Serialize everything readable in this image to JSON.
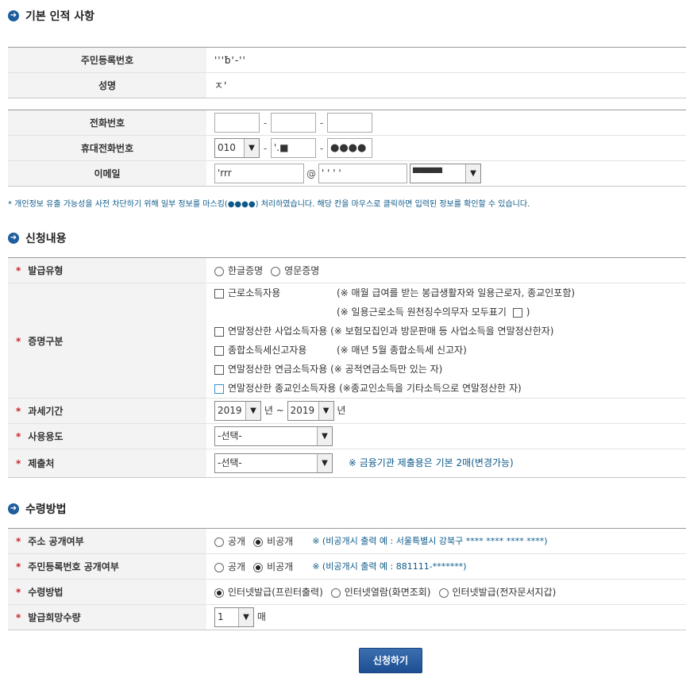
{
  "sections": {
    "basic": "기본 인적 사항",
    "request": "신청내용",
    "receive": "수령방법"
  },
  "personal": {
    "rrn_label": "주민등록번호",
    "rrn_value": "'''ƀ'-''",
    "name_label": "성명",
    "name_value": "ㅈ'"
  },
  "contact": {
    "phone_label": "전화번호",
    "phone_dash": "-",
    "mobile_label": "휴대전화번호",
    "mobile_prefix": "010",
    "mobile_mid": "'.■",
    "mobile_last": "●●●●",
    "email_label": "이메일",
    "email_id": "'rrr",
    "email_at": "@",
    "email_domain": "'   '  ' '",
    "email_domain_select": "▀▀▀▀"
  },
  "notice": "* 개인정보 유출 가능성을 사전 차단하기 위해 일부 정보를 마스킹(●●●●) 처리하였습니다. 해당 칸을 마우스로 클릭하면 입력된 정보를 확인할 수 있습니다.",
  "request": {
    "type_label": "발급유형",
    "type_korean": "한글증명",
    "type_english": "영문증명",
    "cert_label": "증명구분",
    "cert1": "근로소득자용",
    "cert1_note": "(※ 매월 급여를 받는 봉급생활자와 일용근로자, 종교인포함)",
    "cert1_sub": "(※ 일용근로소득 원천징수의무자 모두표기",
    "cert1_sub_end": ")",
    "cert2": "연말정산한 사업소득자용",
    "cert2_note": "(※ 보험모집인과 방문판매 등 사업소득을 연말정산한자)",
    "cert3": "종합소득세신고자용",
    "cert3_note": "(※ 매년 5월 종합소득세 신고자)",
    "cert4": "연말정산한 연금소득자용",
    "cert4_note": "(※ 공적연금소득만 있는 자)",
    "cert5": "연말정산한 종교인소득자용",
    "cert5_note": "(※종교인소득을 기타소득으로 연말정산한 자)",
    "period_label": "과세기간",
    "period_from": "2019",
    "period_year1": "년",
    "period_tilde": "~",
    "period_to": "2019",
    "period_year2": "년",
    "usage_label": "사용용도",
    "usage_value": "-선택-",
    "submit_to_label": "제출처",
    "submit_to_value": "-선택-",
    "submit_to_note": "※ 금융기관 제출용은 기본 2매(변경가능)"
  },
  "receive": {
    "addr_label": "주소 공개여부",
    "public": "공개",
    "private": "비공개",
    "addr_note": "※ (비공개시 출력 예 : 서울특별시 강북구 **** **** **** ****)",
    "rrn_label": "주민등록번호 공개여부",
    "rrn_note": "※ (비공개시 출력 예 : 881111-*******)",
    "method_label": "수령방법",
    "method1": "인터넷발급(프린터출력)",
    "method2": "인터넷열람(화면조회)",
    "method3": "인터넷발급(전자문서지갑)",
    "qty_label": "발급희망수량",
    "qty_value": "1",
    "qty_unit": "매"
  },
  "submit_button": "신청하기",
  "colors": {
    "accent": "#1f5e9e",
    "note": "#0d5a8a",
    "required": "#c0272d"
  }
}
